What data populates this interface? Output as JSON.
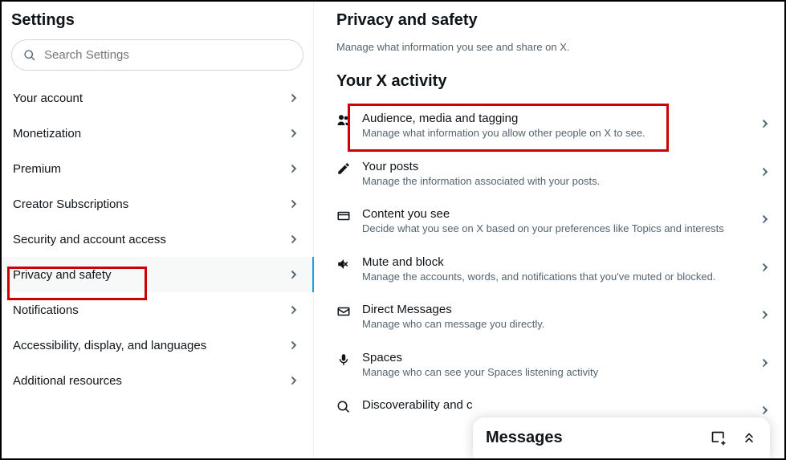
{
  "left": {
    "title": "Settings",
    "search_placeholder": "Search Settings",
    "items": [
      "Your account",
      "Monetization",
      "Premium",
      "Creator Subscriptions",
      "Security and account access",
      "Privacy and safety",
      "Notifications",
      "Accessibility, display, and languages",
      "Additional resources"
    ],
    "active_index": 5
  },
  "right": {
    "title": "Privacy and safety",
    "subtitle": "Manage what information you see and share on X.",
    "section": "Your X activity",
    "options": [
      {
        "icon": "people",
        "title": "Audience, media and tagging",
        "desc": "Manage what information you allow other people on X to see."
      },
      {
        "icon": "pencil",
        "title": "Your posts",
        "desc": "Manage the information associated with your posts."
      },
      {
        "icon": "card",
        "title": "Content you see",
        "desc": "Decide what you see on X based on your preferences like Topics and interests"
      },
      {
        "icon": "mute",
        "title": "Mute and block",
        "desc": "Manage the accounts, words, and notifications that you've muted or blocked."
      },
      {
        "icon": "envelope",
        "title": "Direct Messages",
        "desc": "Manage who can message you directly."
      },
      {
        "icon": "mic",
        "title": "Spaces",
        "desc": "Manage who can see your Spaces listening activity"
      },
      {
        "icon": "search",
        "title": "Discoverability and c",
        "desc": ""
      }
    ]
  },
  "messages": {
    "title": "Messages"
  }
}
